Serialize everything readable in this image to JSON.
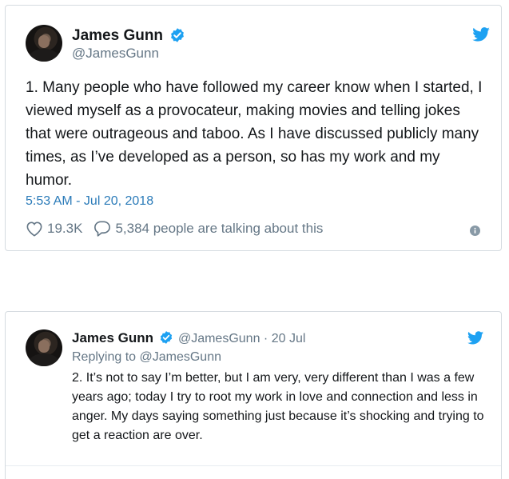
{
  "tweet1": {
    "name": "James Gunn",
    "handle": "@JamesGunn",
    "text": "1. Many people who have followed my career know when I started, I viewed myself as a provocateur, making movies and telling jokes that were outrageous and taboo. As I have discussed publicly many times, as I’ve developed as a person, so has my work and my humor.",
    "timestamp": "5:53 AM - Jul 20, 2018",
    "likes": "19.3K",
    "talking": "5,384 people are talking about this",
    "icons": {
      "verified": "verified-badge-icon",
      "twitter": "twitter-bird-icon",
      "like": "heart-icon",
      "comment": "speech-bubble-icon",
      "info": "info-icon"
    },
    "colors": {
      "verified": "#1da1f2",
      "link": "#2b7bb9",
      "muted": "#657786"
    }
  },
  "tweet2": {
    "name": "James Gunn",
    "handle": "@JamesGunn",
    "separator": "·",
    "date": "20 Jul",
    "replying_to": "Replying to @JamesGunn",
    "text": "2. It’s not to say I’m better, but I am very, very different than I was a few years ago; today I try to root my work in love and connection and less in anger.  My days saying something just because it’s shocking and trying to get a reaction are over."
  }
}
